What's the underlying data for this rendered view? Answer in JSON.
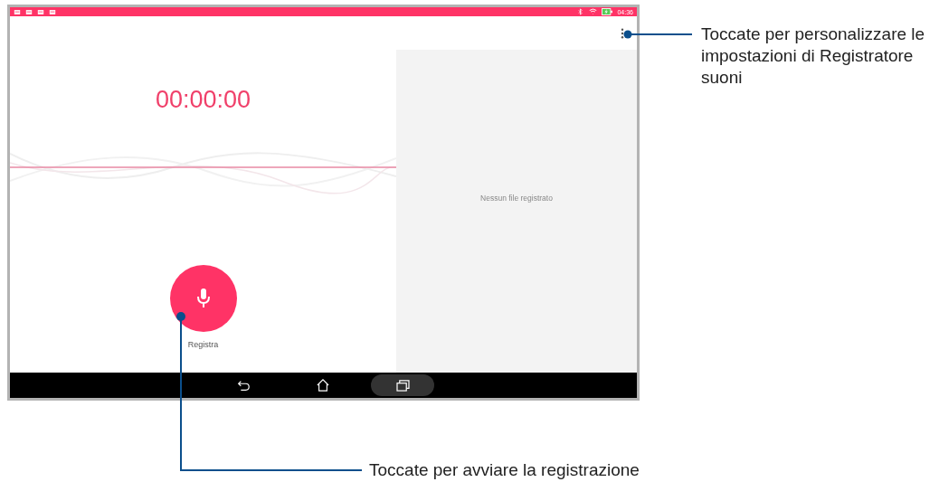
{
  "status_bar": {
    "time": "04:36"
  },
  "recorder": {
    "timer": "00:00:00",
    "record_button": {
      "label": "Registra"
    }
  },
  "recordings_panel": {
    "empty_message": "Nessun file registrato"
  },
  "callouts": [
    {
      "text": "Toccate per personalizzare le impostazioni di Registratore suoni"
    },
    {
      "text": "Toccate per avviare la registrazione"
    }
  ]
}
